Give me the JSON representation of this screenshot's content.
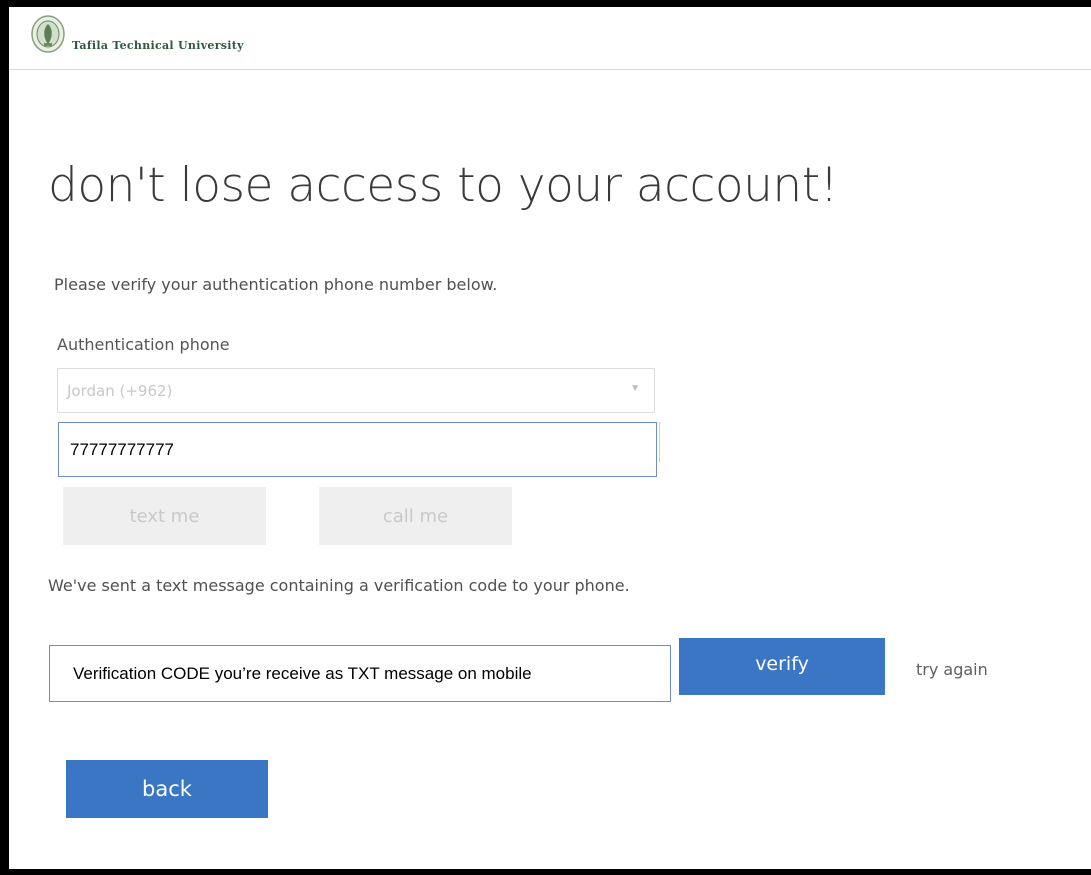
{
  "header": {
    "logo_text": "Tafila Technical University",
    "logo_icon": "university-emblem"
  },
  "page": {
    "title": "don't lose access to your account!",
    "instructions": "Please verify your authentication phone number below."
  },
  "phone": {
    "label": "Authentication phone",
    "country_value": "Jordan (+962)",
    "dropdown_icon": "chevron-down-icon",
    "number_value": "77777777777"
  },
  "buttons": {
    "text_me": "text me",
    "call_me": "call me",
    "verify": "verify",
    "try_again": "try again",
    "back": "back"
  },
  "verification": {
    "sent_message": "We've sent a text message containing a verification code to your phone.",
    "code_value": "Verification CODE you’re receive as TXT message on mobile"
  },
  "colors": {
    "primary_button": "#3a76c4",
    "input_focus_border": "#6d8fc9",
    "disabled_button": "#efefef"
  }
}
